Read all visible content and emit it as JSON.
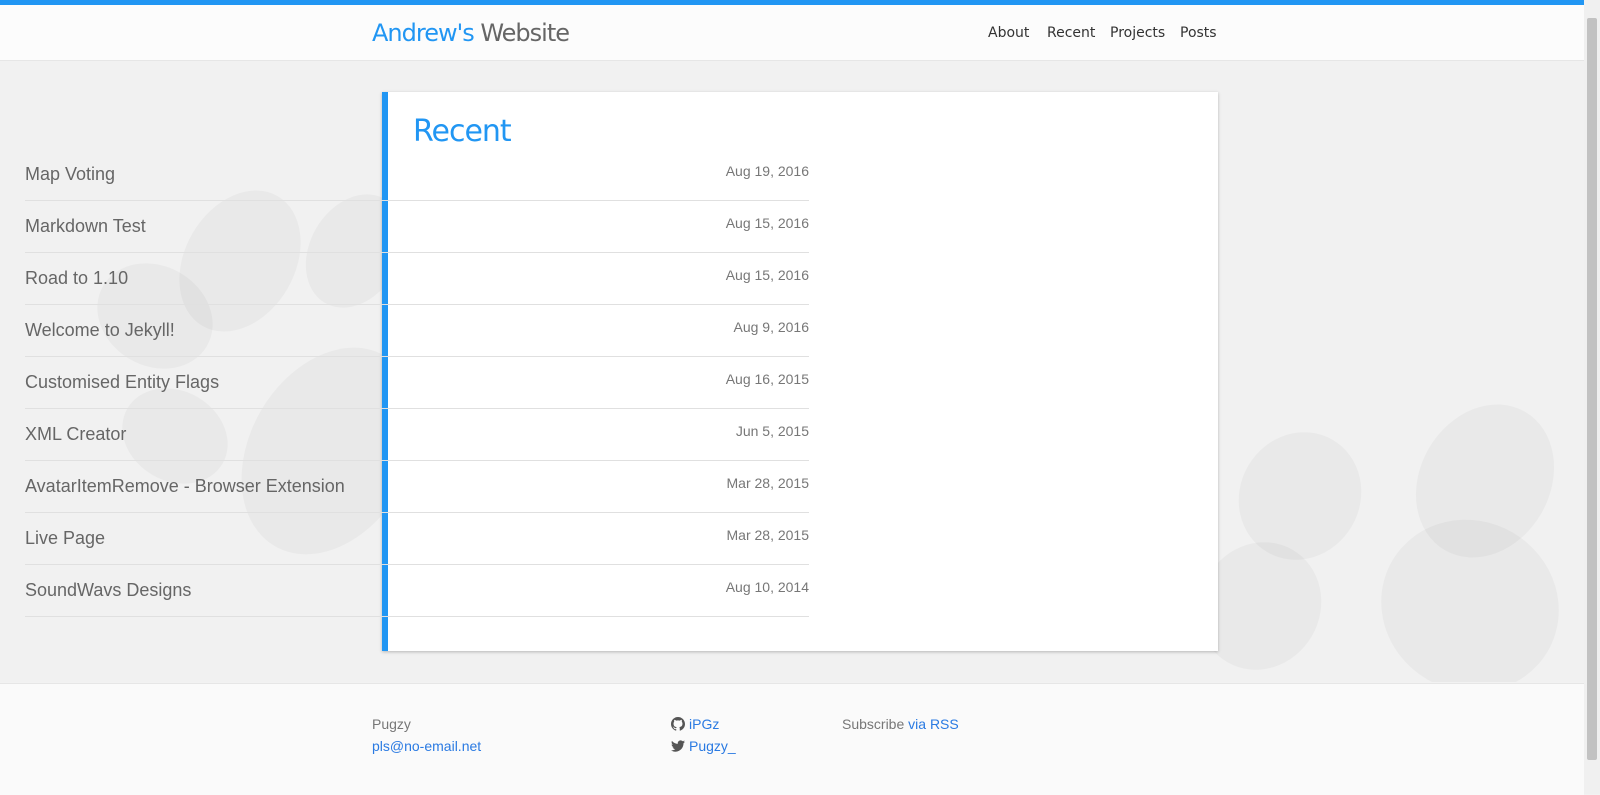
{
  "header": {
    "brand_part1": "Andrew's",
    "brand_part2": "Website",
    "nav": [
      "About",
      "Recent",
      "Projects",
      "Posts"
    ]
  },
  "main": {
    "title": "Recent",
    "posts": [
      {
        "title": "Map Voting",
        "date": "Aug 19, 2016"
      },
      {
        "title": "Markdown Test",
        "date": "Aug 15, 2016"
      },
      {
        "title": "Road to 1.10",
        "date": "Aug 15, 2016"
      },
      {
        "title": "Welcome to Jekyll!",
        "date": "Aug 9, 2016"
      },
      {
        "title": "Customised Entity Flags",
        "date": "Aug 16, 2015"
      },
      {
        "title": "XML Creator",
        "date": "Jun 5, 2015"
      },
      {
        "title": "AvatarItemRemove - Browser Extension",
        "date": "Mar 28, 2015"
      },
      {
        "title": "Live Page",
        "date": "Mar 28, 2015"
      },
      {
        "title": "SoundWavs Designs",
        "date": "Aug 10, 2014"
      }
    ]
  },
  "footer": {
    "name": "Pugzy",
    "email": "pls@no-email.net",
    "github": "iPGz",
    "twitter": "Pugzy_",
    "subscribe_text": "Subscribe",
    "subscribe_link": "via RSS"
  },
  "colors": {
    "accent": "#2196f3",
    "link": "#2a7ae2"
  }
}
